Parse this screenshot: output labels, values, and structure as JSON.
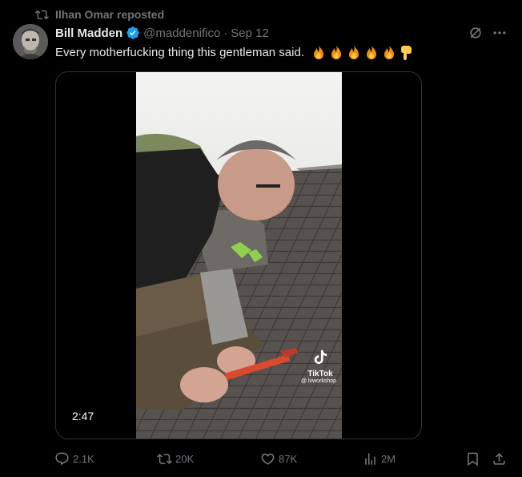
{
  "repost_banner": {
    "text": "Ilhan Omar reposted",
    "icon": "repost-icon"
  },
  "author": {
    "name": "Bill Madden",
    "handle": "@maddenifico",
    "separator": "·",
    "date": "Sep 12",
    "verified_color": "#1d9bf0"
  },
  "tweet": {
    "text": "Every motherfucking thing this gentleman said.",
    "emojis": [
      "🔥",
      "🔥",
      "🔥",
      "🔥",
      "🔥",
      "👇"
    ]
  },
  "media": {
    "duration": "2:47",
    "watermark_brand": "TikTok",
    "watermark_user": "@ lvworkshop"
  },
  "actions": {
    "replies": "2.1K",
    "reposts": "20K",
    "likes": "87K",
    "views": "2M"
  },
  "colors": {
    "background": "#000000",
    "text_primary": "#e7e9ea",
    "text_secondary": "#71767b",
    "border": "#2f3336",
    "accent": "#1d9bf0"
  }
}
